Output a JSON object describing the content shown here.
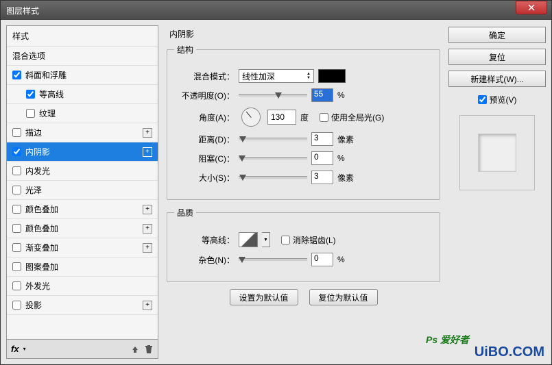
{
  "window_title": "图层样式",
  "left": {
    "header": "样式",
    "blending_options": "混合选项",
    "items": [
      {
        "label": "斜面和浮雕",
        "checked": true,
        "plus": false
      },
      {
        "label": "等高线",
        "checked": true,
        "sub": true
      },
      {
        "label": "纹理",
        "checked": false,
        "sub": true
      },
      {
        "label": "描边",
        "checked": false,
        "plus": true
      },
      {
        "label": "内阴影",
        "checked": true,
        "plus": true,
        "selected": true
      },
      {
        "label": "内发光",
        "checked": false
      },
      {
        "label": "光泽",
        "checked": false
      },
      {
        "label": "颜色叠加",
        "checked": false,
        "plus": true
      },
      {
        "label": "颜色叠加",
        "checked": false,
        "plus": true
      },
      {
        "label": "渐变叠加",
        "checked": false,
        "plus": true
      },
      {
        "label": "图案叠加",
        "checked": false
      },
      {
        "label": "外发光",
        "checked": false
      },
      {
        "label": "投影",
        "checked": false,
        "plus": true
      }
    ],
    "fx_label": "fx"
  },
  "mid": {
    "panel_title": "内阴影",
    "structure_legend": "结构",
    "quality_legend": "品质",
    "blend_mode_label": "混合模式：",
    "blend_mode_value": "线性加深",
    "blend_color": "#000000",
    "opacity_label": "不透明度(O)：",
    "opacity_value": "55",
    "opacity_unit": "%",
    "angle_label": "角度(A)：",
    "angle_value": "130",
    "angle_unit": "度",
    "global_light_label": "使用全局光(G)",
    "global_light_checked": false,
    "distance_label": "距离(D)：",
    "distance_value": "3",
    "distance_unit": "像素",
    "choke_label": "阻塞(C)：",
    "choke_value": "0",
    "choke_unit": "%",
    "size_label": "大小(S)：",
    "size_value": "3",
    "size_unit": "像素",
    "contour_label": "等高线：",
    "antialias_label": "消除锯齿(L)",
    "antialias_checked": false,
    "noise_label": "杂色(N)：",
    "noise_value": "0",
    "noise_unit": "%",
    "set_default": "设置为默认值",
    "reset_default": "复位为默认值"
  },
  "right": {
    "ok": "确定",
    "reset": "复位",
    "new_style": "新建样式(W)...",
    "preview_label": "预览(V)",
    "preview_checked": true
  },
  "watermark": "UiBO.COM",
  "watermark_ps": "Ps 爱好者"
}
